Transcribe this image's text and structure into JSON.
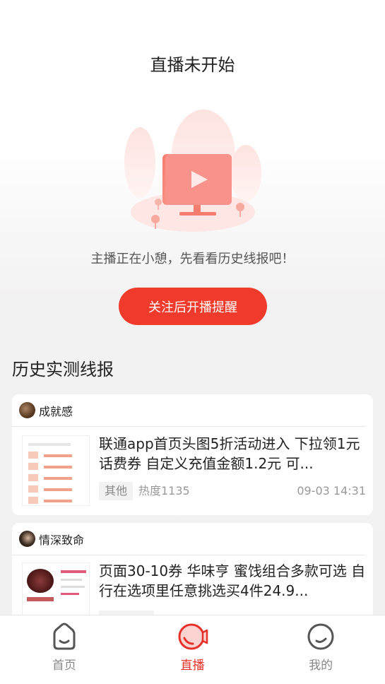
{
  "status": {
    "title": "直播未开始",
    "hint": "主播正在小憩，先看看历史线报吧！",
    "follow_button": "关注后开播提醒"
  },
  "history": {
    "section_title": "历史实测线报",
    "items": [
      {
        "author": "成就感",
        "title": "联通app首页头图5折活动进入 下拉领1元话费券 自定义充值金额1.2元 可...",
        "tag": "其他",
        "heat": "热度1135",
        "time": "09-03 14:31"
      },
      {
        "author": "情深致命",
        "title": "页面30-10券 华味亨 蜜饯组合多款可选 自行在选项里任意挑选买4件24.9...",
        "tag": "",
        "heat": "",
        "time": ""
      }
    ]
  },
  "tabbar": {
    "items": [
      {
        "label": "首页",
        "icon": "home-icon",
        "active": false
      },
      {
        "label": "直播",
        "icon": "live-icon",
        "active": true
      },
      {
        "label": "我的",
        "icon": "profile-icon",
        "active": false
      }
    ]
  },
  "colors": {
    "accent": "#f03a2c",
    "active_tab": "#e8302a"
  }
}
